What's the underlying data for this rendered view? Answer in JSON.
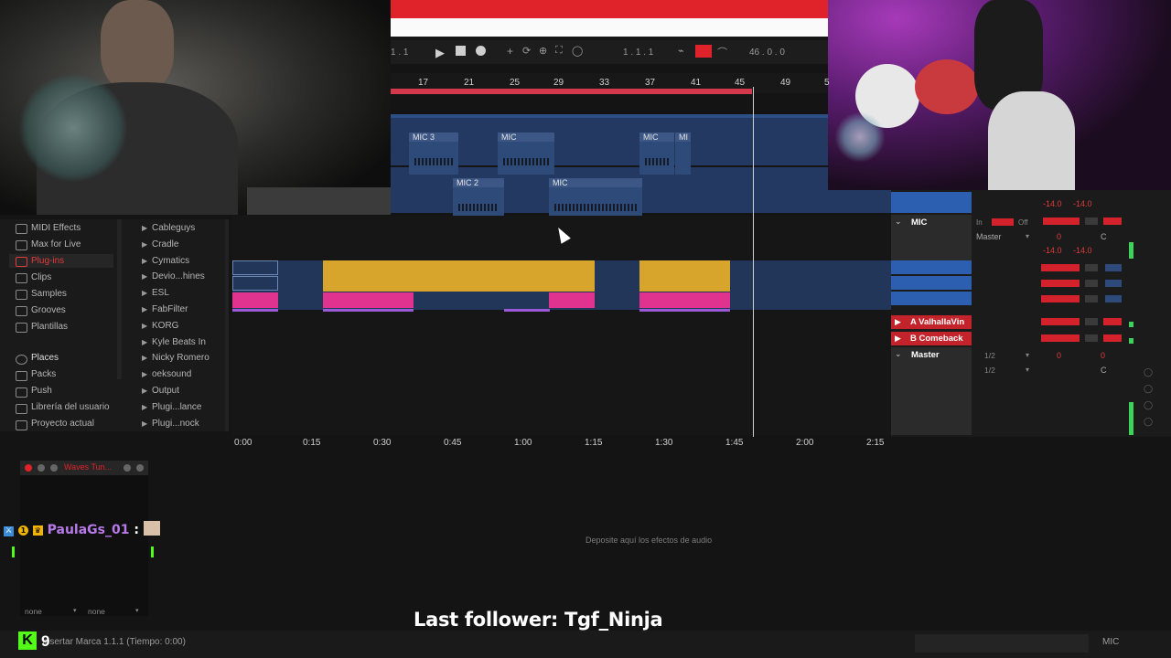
{
  "transport": {
    "position": "1 . 1",
    "counter": "1 .  1 .  1",
    "loop_length": "46 .  0 .  0"
  },
  "bar_ruler": [
    "17",
    "21",
    "25",
    "29",
    "33",
    "37",
    "41",
    "45",
    "49",
    "5"
  ],
  "arrangement_clips": [
    {
      "label": "MIC 3"
    },
    {
      "label": "MIC"
    },
    {
      "label": "MIC"
    },
    {
      "label": "MI"
    },
    {
      "label": "MIC 2"
    },
    {
      "label": "MIC"
    }
  ],
  "browser": {
    "categories": [
      {
        "label": "MIDI Effects",
        "icon": "midi-icon"
      },
      {
        "label": "Max for Live",
        "icon": "max-icon"
      },
      {
        "label": "Plug-ins",
        "icon": "plugin-icon",
        "selected": true
      },
      {
        "label": "Clips",
        "icon": "clip-icon"
      },
      {
        "label": "Samples",
        "icon": "waveform-icon"
      },
      {
        "label": "Grooves",
        "icon": "groove-icon"
      },
      {
        "label": "Plantillas",
        "icon": "template-icon"
      }
    ],
    "places_header": "Places",
    "places": [
      {
        "label": "Packs",
        "icon": "package-icon"
      },
      {
        "label": "Push",
        "icon": "push-icon"
      },
      {
        "label": "Librería del usuario",
        "icon": "folder-icon"
      },
      {
        "label": "Proyecto actual",
        "icon": "folder-icon"
      }
    ],
    "items": [
      "Cableguys",
      "Cradle",
      "Cymatics",
      "Devio...hines",
      "ESL",
      "FabFilter",
      "KORG",
      "Kyle Beats In",
      "Nicky Romero",
      "oeksound",
      "Output",
      "Plugi...lance",
      "Plugi...nock"
    ]
  },
  "time_axis": [
    "0:00",
    "0:15",
    "0:30",
    "0:45",
    "1:00",
    "1:15",
    "1:30",
    "1:45",
    "2:00",
    "2:15"
  ],
  "tracks": {
    "mic": "MIC",
    "return_a": "A ValhallaVin",
    "return_b": "B Comeback",
    "master": "Master"
  },
  "mixer": {
    "master_label": "Master",
    "routing_master": "Master",
    "in_label": "In",
    "off_label": "Off",
    "vol1": "-14.0",
    "vol2": "-14.0",
    "vol3": "-14.0",
    "vol4": "-14.0",
    "send": "0",
    "pan": "C",
    "send_half_a": "1/2",
    "send_half_b": "1/2",
    "ret_send": "0"
  },
  "device_pane": {
    "drop_hint": "Deposite aquí los efectos de audio",
    "plugin_title": "Waves Tun...",
    "sel_a": "none",
    "sel_b": "none"
  },
  "overlay": {
    "last_follower": "Last follower: Tgf_Ninja",
    "chat_user": "PaulaGs_01",
    "chat_sep": ":",
    "kick_count": "9"
  },
  "status": {
    "message": "Insertar Marca 1.1.1 (Tiempo: 0:00)",
    "track_name": "MIC"
  },
  "colors": {
    "accent_red": "#e0222a",
    "clip_yellow": "#d8a52c",
    "clip_pink": "#e0338f",
    "clip_blue": "#2c4f85",
    "follower_text": "#ffffff",
    "chat_name": "#b77ae8",
    "kick_green": "#53fc18"
  }
}
